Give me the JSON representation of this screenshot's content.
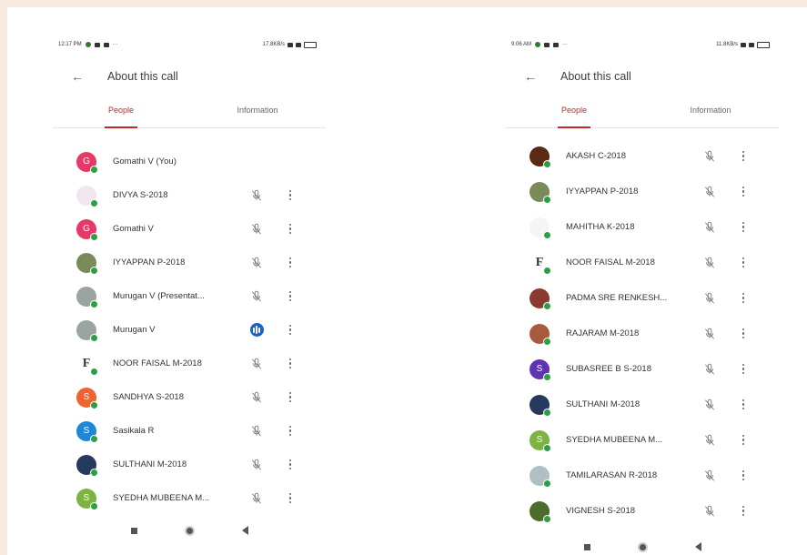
{
  "colors": {
    "accent": "#c62828",
    "online": "#2e9e44",
    "speaking": "#1a62c4"
  },
  "left": {
    "status": {
      "time": "12:17 PM",
      "net": "17.8KB/s"
    },
    "title": "About this call",
    "tabs": [
      "People",
      "Information"
    ],
    "people": [
      {
        "name": "Gomathi V (You)",
        "avatar": "G",
        "color": "#e53968",
        "mic": "none"
      },
      {
        "name": "DIVYA S-2018",
        "avatar": "",
        "color": "#f1e6ee",
        "mic": "muted"
      },
      {
        "name": "Gomathi V",
        "avatar": "G",
        "color": "#e53968",
        "mic": "muted"
      },
      {
        "name": "IYYAPPAN P-2018",
        "avatar": "",
        "color": "#7b8a5a",
        "mic": "muted"
      },
      {
        "name": "Murugan V (Presentat...",
        "avatar": "",
        "color": "#9aa5a0",
        "mic": "muted"
      },
      {
        "name": "Murugan V",
        "avatar": "",
        "color": "#9aa5a0",
        "mic": "speaking"
      },
      {
        "name": "NOOR FAISAL M-2018",
        "avatar": "F",
        "color": "#ffffff",
        "mic": "muted"
      },
      {
        "name": "SANDHYA S-2018",
        "avatar": "S",
        "color": "#f0622e",
        "mic": "muted"
      },
      {
        "name": "Sasikala R",
        "avatar": "S",
        "color": "#1e88d8",
        "mic": "muted"
      },
      {
        "name": "SULTHANI M-2018",
        "avatar": "",
        "color": "#263a5e",
        "mic": "muted"
      },
      {
        "name": "SYEDHA MUBEENA M...",
        "avatar": "S",
        "color": "#7cb342",
        "mic": "muted"
      }
    ]
  },
  "right": {
    "status": {
      "time": "9:06 AM",
      "net": "11.8KB/s"
    },
    "title": "About this call",
    "tabs": [
      "People",
      "Information"
    ],
    "people": [
      {
        "name": "AKASH C-2018",
        "avatar": "",
        "color": "#5a2a14",
        "mic": "muted"
      },
      {
        "name": "IYYAPPAN P-2018",
        "avatar": "",
        "color": "#7b8a5a",
        "mic": "muted"
      },
      {
        "name": "MAHITHA K-2018",
        "avatar": "",
        "color": "#f5f5f5",
        "mic": "muted"
      },
      {
        "name": "NOOR FAISAL M-2018",
        "avatar": "F",
        "color": "#ffffff",
        "mic": "muted"
      },
      {
        "name": "PADMA SRE RENKESH...",
        "avatar": "",
        "color": "#8a3a2e",
        "mic": "muted"
      },
      {
        "name": "RAJARAM M-2018",
        "avatar": "",
        "color": "#a85a3e",
        "mic": "muted"
      },
      {
        "name": "SUBASREE B S-2018",
        "avatar": "S",
        "color": "#5e35b1",
        "mic": "muted"
      },
      {
        "name": "SULTHANI M-2018",
        "avatar": "",
        "color": "#263a5e",
        "mic": "muted"
      },
      {
        "name": "SYEDHA MUBEENA M...",
        "avatar": "S",
        "color": "#7cb342",
        "mic": "muted"
      },
      {
        "name": "TAMILARASAN R-2018",
        "avatar": "",
        "color": "#b0bec5",
        "mic": "muted"
      },
      {
        "name": "VIGNESH S-2018",
        "avatar": "",
        "color": "#4e6b2e",
        "mic": "muted"
      }
    ]
  }
}
